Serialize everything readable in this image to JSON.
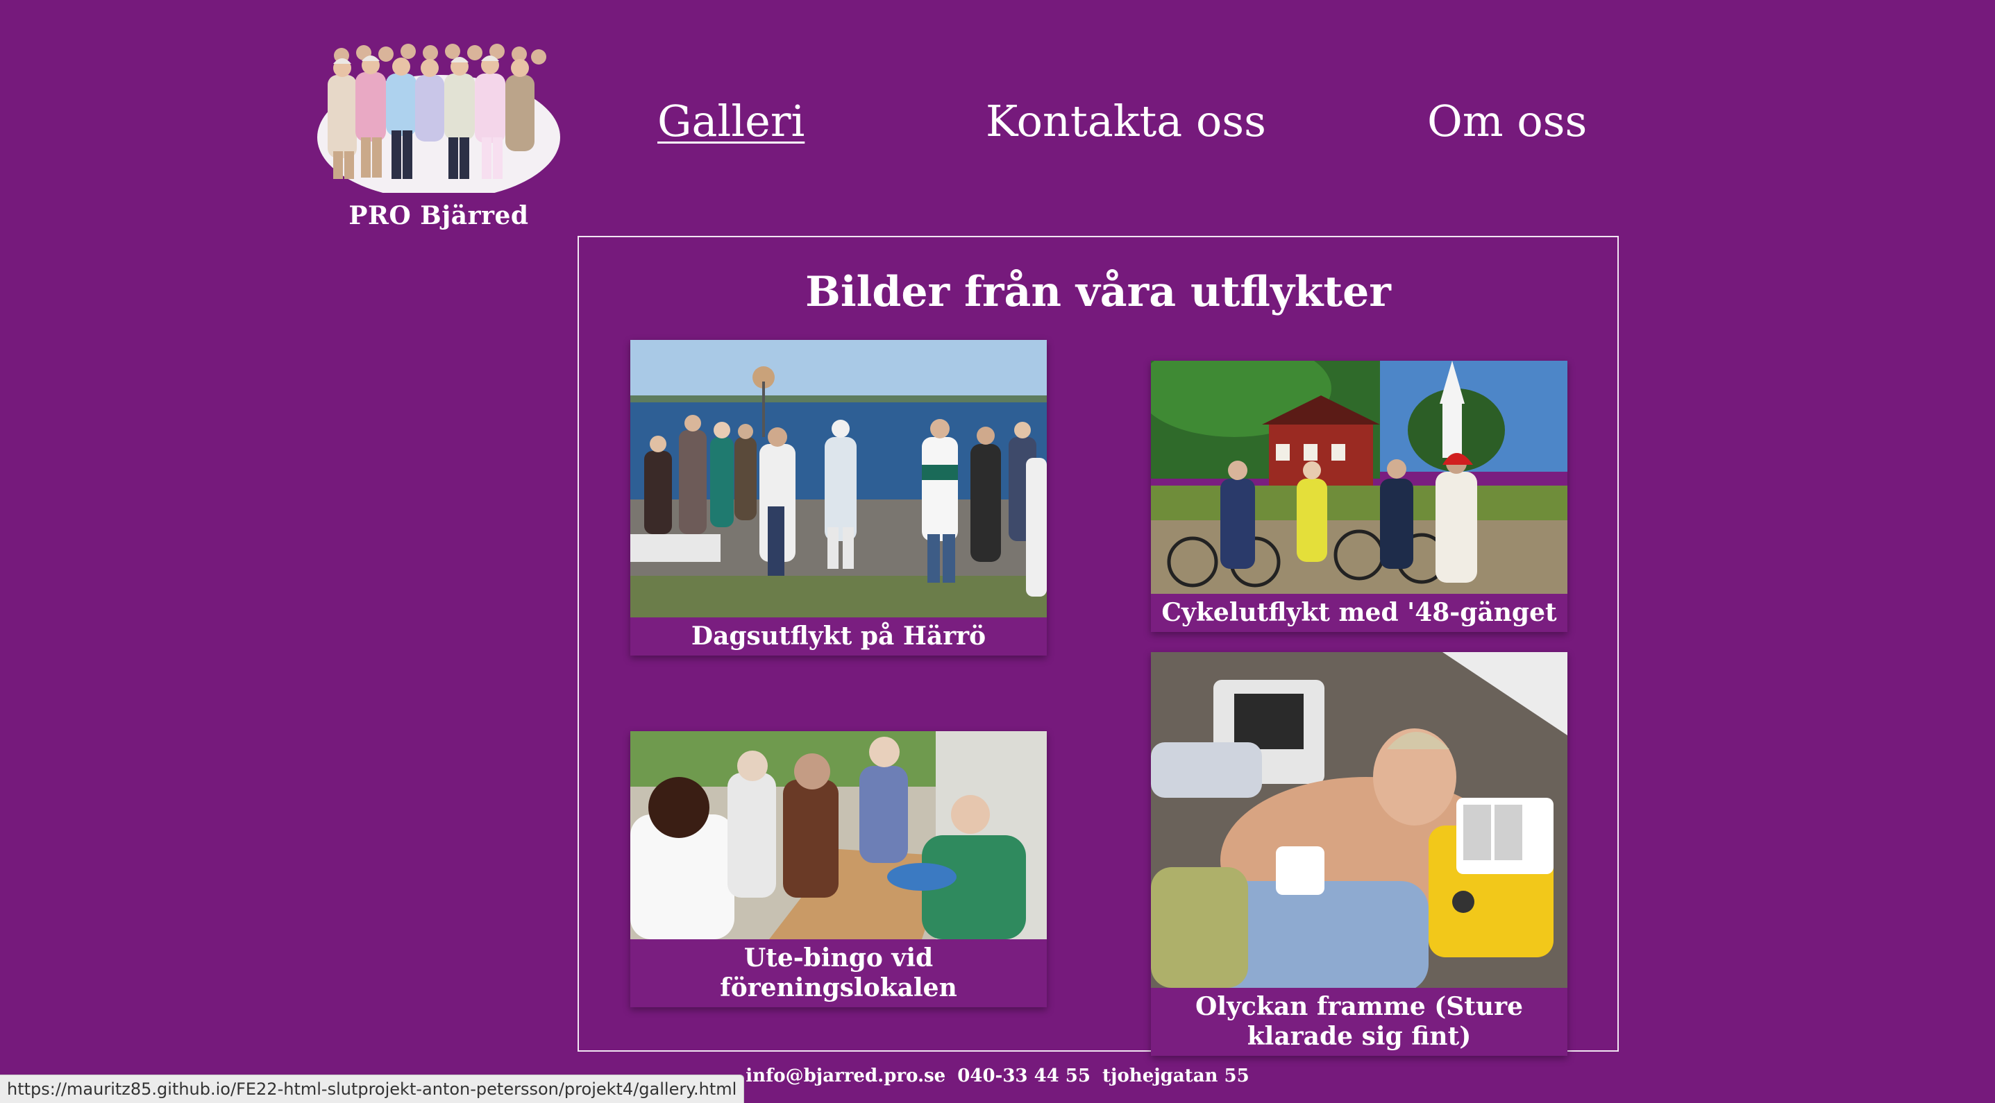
{
  "site": {
    "name": "PRO Bjärred",
    "logo_icon": "group-photo-logo"
  },
  "nav": {
    "items": [
      {
        "label": "Galleri",
        "active": true
      },
      {
        "label": "Kontakta oss",
        "active": false
      },
      {
        "label": "Om oss",
        "active": false
      }
    ]
  },
  "gallery": {
    "title": "Bilder från våra utflykter",
    "items": [
      {
        "caption": "Dagsutflykt på Härrö",
        "image": "group-by-sea-photo"
      },
      {
        "caption": "Cykelutflykt med '48-gänget",
        "image": "cyclists-church-photo"
      },
      {
        "caption": "Ute-bingo vid föreningslokalen",
        "image": "outdoor-bingo-photo"
      },
      {
        "caption": "Olyckan framme (Sture klarade sig fint)",
        "image": "defibrillator-photo"
      }
    ]
  },
  "footer": {
    "email": "info@bjarred.pro.se",
    "phone": "040-33 44 55",
    "address": "tjohejgatan 55"
  },
  "status_bar": {
    "url": "https://mauritz85.github.io/FE22-html-slutprojekt-anton-petersson/projekt4/gallery.html"
  },
  "colors": {
    "background": "#761a7c",
    "text": "#ffffff",
    "border": "#f2e6f3"
  }
}
